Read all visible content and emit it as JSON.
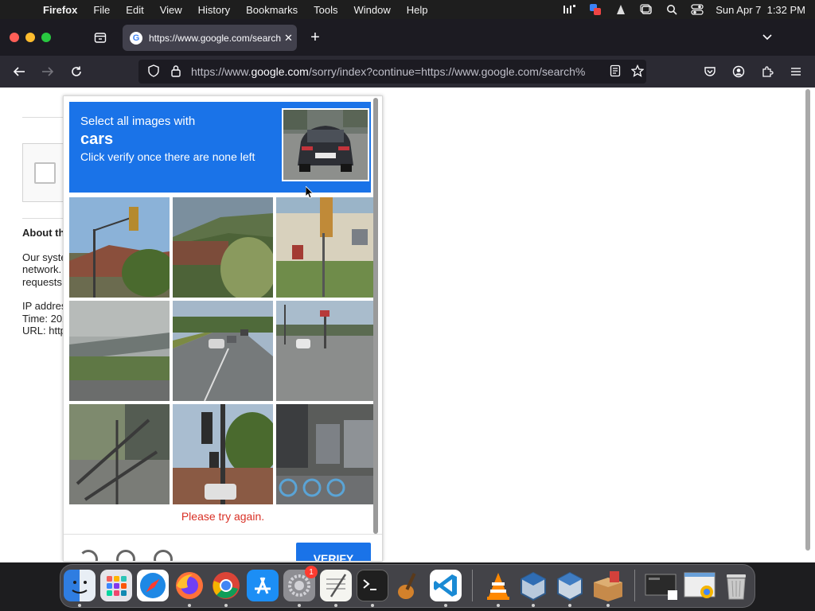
{
  "menubar": {
    "app_name": "Firefox",
    "menus": [
      "File",
      "Edit",
      "View",
      "History",
      "Bookmarks",
      "Tools",
      "Window",
      "Help"
    ],
    "clock": "Sun Apr 7  1:32 PM"
  },
  "browser": {
    "tab_title": "https://www.google.com/search",
    "url_prefix": "https://www.",
    "url_domain": "google.com",
    "url_rest": "/sorry/index?continue=https://www.google.com/search%"
  },
  "page": {
    "about_heading": "About th",
    "para1": [
      "Our syste",
      "network.",
      "requests"
    ],
    "para2": [
      "IP addres",
      "Time: 202",
      "URL: http"
    ]
  },
  "captcha": {
    "instruction": "Select all images with",
    "target": "cars",
    "subtext": "Click verify once there are none left",
    "error": "Please try again.",
    "verify_label": "VERIFY",
    "tiles": [
      "traffic-light-tree",
      "bushes",
      "traffic-light-house",
      "overpass",
      "highway-cars",
      "intersection",
      "fence",
      "traffic-light-street",
      "bike-share"
    ]
  },
  "dock": {
    "apps": [
      "Finder",
      "Launchpad",
      "Safari",
      "Firefox",
      "Chrome",
      "App Store",
      "System Settings",
      "TextEdit",
      "Terminal",
      "GarageBand",
      "VS Code",
      "VLC",
      "VirtualBox",
      "VirtualBox VM",
      "Installer",
      "Screenshots",
      "Preview",
      "Trash"
    ],
    "settings_badge": "1"
  },
  "colors": {
    "captcha_blue": "#1a73e8",
    "error_red": "#d93025"
  }
}
